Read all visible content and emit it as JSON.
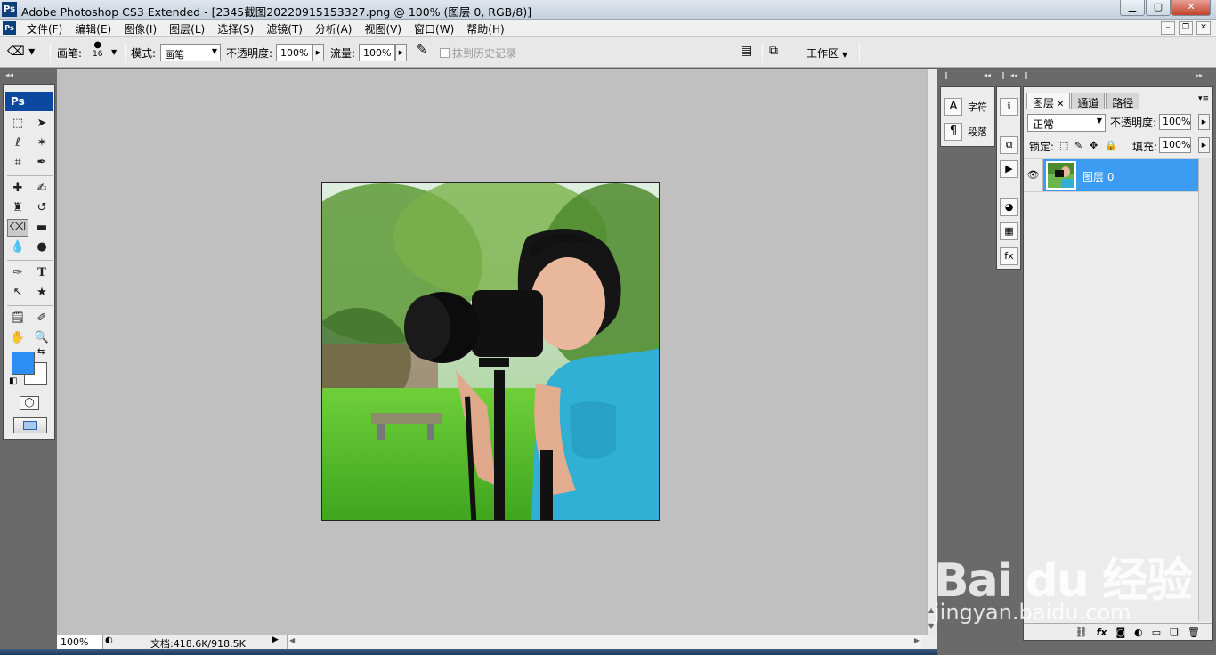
{
  "window": {
    "title": "Adobe Photoshop CS3 Extended - [2345截图20220915153327.png @ 100% (图层 0, RGB/8)]",
    "app_icon": "Ps",
    "controls": [
      "minimize-icon",
      "maximize-icon",
      "close-icon"
    ]
  },
  "menu": {
    "items": [
      "文件(F)",
      "编辑(E)",
      "图像(I)",
      "图层(L)",
      "选择(S)",
      "滤镜(T)",
      "分析(A)",
      "视图(V)",
      "窗口(W)",
      "帮助(H)"
    ]
  },
  "options": {
    "brush_label": "画笔:",
    "brush_size": "16",
    "mode_label": "模式:",
    "mode_value": "画笔",
    "opacity_label": "不透明度:",
    "opacity_value": "100%",
    "flow_label": "流量:",
    "flow_value": "100%",
    "erase_history_label": "抹到历史记录",
    "workspace_label": "工作区"
  },
  "toolbox": {
    "header": "Ps",
    "foreground_color": "#2b8ef5",
    "background_color": "#ffffff",
    "tools": [
      "marquee-icon",
      "move-icon",
      "lasso-icon",
      "magic-wand-icon",
      "crop-icon",
      "slice-icon",
      "healing-brush-icon",
      "brush-icon",
      "clone-stamp-icon",
      "history-brush-icon",
      "eraser-icon",
      "gradient-icon",
      "blur-icon",
      "dodge-icon",
      "pen-icon",
      "type-icon",
      "path-selection-icon",
      "shape-icon",
      "notes-icon",
      "eyedropper-icon",
      "hand-icon",
      "zoom-icon"
    ]
  },
  "status": {
    "zoom": "100%",
    "doc_info": "文档:418.6K/918.5K"
  },
  "dock_mini": {
    "character_label": "字符",
    "paragraph_label": "段落"
  },
  "layers_panel": {
    "tabs": [
      "图层",
      "通道",
      "路径"
    ],
    "blend_mode": "正常",
    "opacity_label": "不透明度:",
    "opacity_value": "100%",
    "lock_label": "锁定:",
    "fill_label": "填充:",
    "fill_value": "100%",
    "layers": [
      {
        "name": "图层 0",
        "visible": true,
        "selected": true
      }
    ]
  },
  "watermark": {
    "brand": "Bai du 经验",
    "url": "jingyan.baidu.com"
  },
  "colors": {
    "accent": "#3b9cf2",
    "canvas_bg": "#c0c0c0",
    "chrome_dark": "#6a6a6a"
  }
}
